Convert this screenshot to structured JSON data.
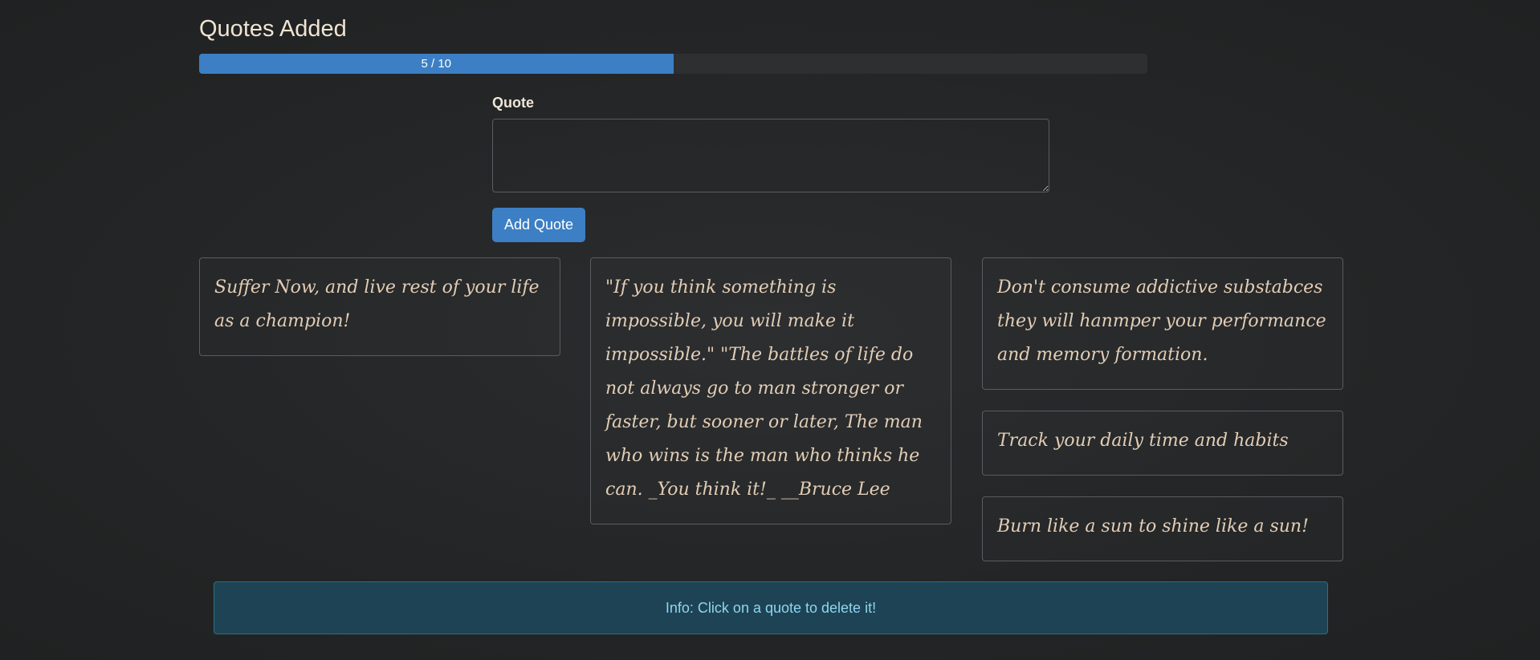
{
  "header": {
    "title": "Quotes Added"
  },
  "progress": {
    "current": 5,
    "max": 10,
    "label": "5 / 10",
    "fraction": 0.5
  },
  "form": {
    "label": "Quote",
    "value": "",
    "button_label": "Add Quote"
  },
  "quotes": [
    {
      "text": "Suffer Now, and live rest of your life as a champion!"
    },
    {
      "text": "\"If you think something is impossible, you will make it impossible.\" \"The battles of life do not always go to man stronger or faster, but sooner or later, The man who wins is the man who thinks he can. _You think it!_ __Bruce Lee"
    },
    {
      "text": "Don't consume addictive substabces they will hanmper your performance and memory formation."
    },
    {
      "text": "Track your daily time and habits"
    },
    {
      "text": "Burn like a sun to shine like a sun!"
    }
  ],
  "alert": {
    "text": "Info: Click on a quote to delete it!"
  },
  "colors": {
    "accent": "#3c7fc4",
    "background": "#232526",
    "quote_text": "#e2cdb5",
    "alert_bg": "#1d4354",
    "alert_text": "#8fd6ef"
  }
}
